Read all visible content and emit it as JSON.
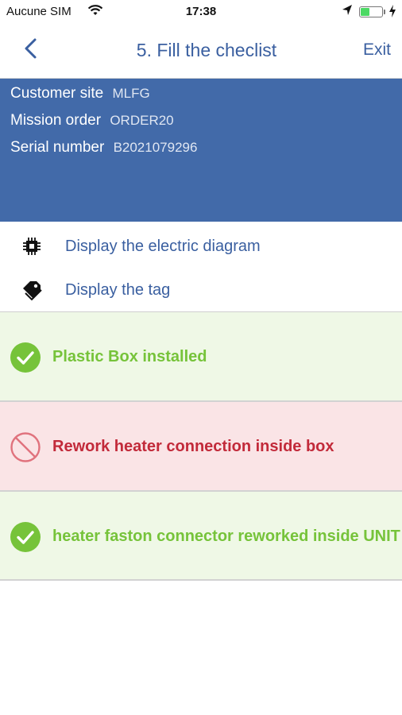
{
  "status_bar": {
    "carrier": "Aucune SIM",
    "time": "17:38",
    "battery_level": 0.45
  },
  "nav": {
    "title": "5. Fill the checlist",
    "exit_label": "Exit"
  },
  "info": {
    "customer_site_label": "Customer site",
    "customer_site_value": "MLFG",
    "mission_order_label": "Mission order",
    "mission_order_value": "ORDER20",
    "serial_number_label": "Serial number",
    "serial_number_value": "B2021079296"
  },
  "actions": {
    "electric_diagram": "Display the electric diagram",
    "tag": "Display the tag"
  },
  "checklist": [
    {
      "label": "Plastic Box installed",
      "status": "ok"
    },
    {
      "label": "Rework heater connection inside box",
      "status": "ko"
    },
    {
      "label": "heater faston connector reworked inside UNIT",
      "status": "ok"
    }
  ],
  "colors": {
    "brand_blue": "#426aa9",
    "ok_green": "#76c33a",
    "ko_red": "#c22a3a"
  }
}
